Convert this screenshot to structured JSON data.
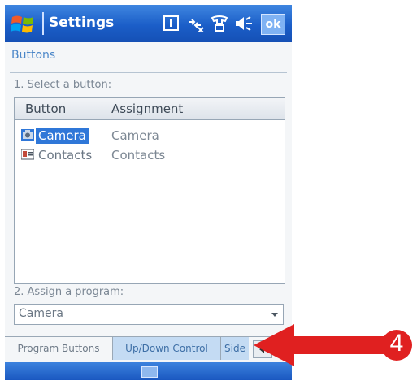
{
  "titlebar": {
    "title": "Settings",
    "ok_label": "ok",
    "status_icons": [
      "keyboard-indicator-icon",
      "connectivity-icon",
      "phone-icon",
      "speaker-icon"
    ]
  },
  "page": {
    "header": "Buttons",
    "select_label": "1. Select a button:",
    "assign_label": "2. Assign a program:"
  },
  "list": {
    "columns": [
      "Button",
      "Assignment"
    ],
    "rows": [
      {
        "button": "Camera",
        "assignment": "Camera",
        "icon": "camera-icon",
        "selected": true
      },
      {
        "button": "Contacts",
        "assignment": "Contacts",
        "icon": "contacts-icon",
        "selected": false
      }
    ]
  },
  "program_dropdown": {
    "value": "Camera"
  },
  "tabs": [
    "Program Buttons",
    "Up/Down Control",
    "Side"
  ],
  "annotation": {
    "number": "4"
  },
  "colors": {
    "titlebar": "#1b5ec8",
    "selection": "#2f77d8",
    "accent_text": "#4a86c8",
    "callout": "#e02020"
  }
}
